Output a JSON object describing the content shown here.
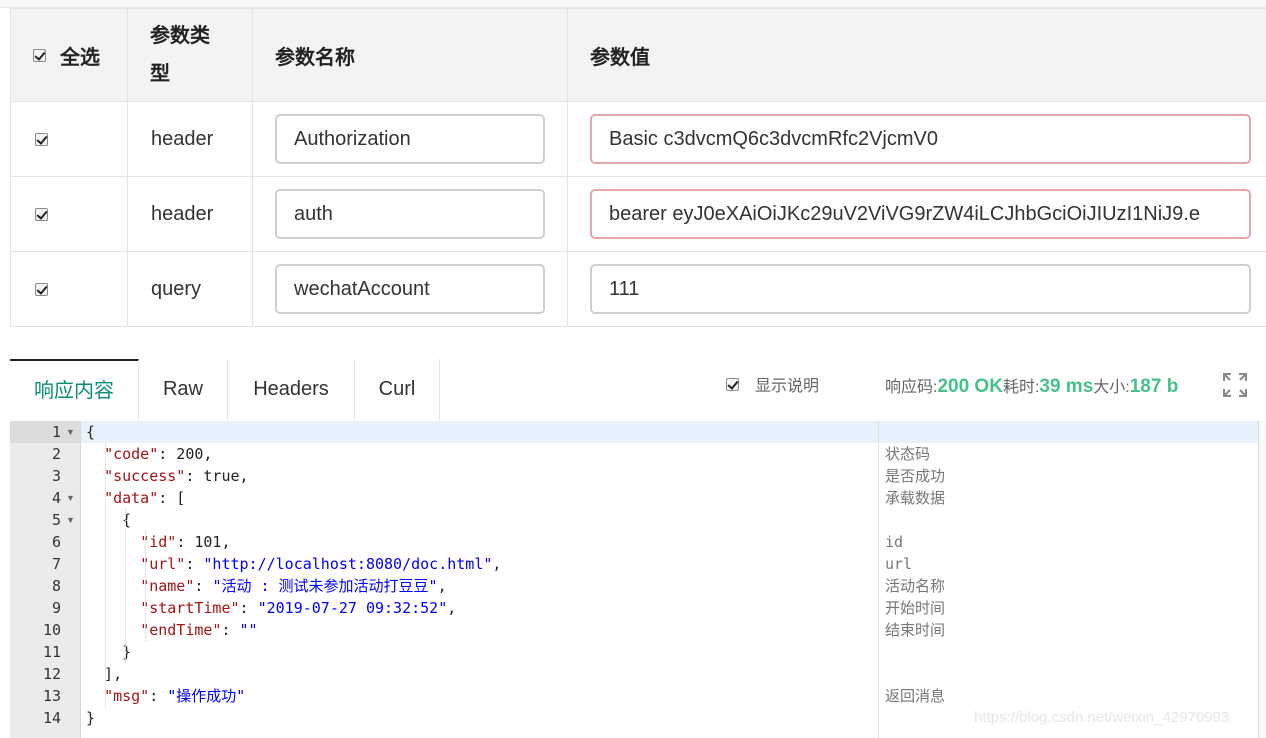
{
  "params": {
    "headers": {
      "select_all": "全选",
      "type": "参数类型",
      "name": "参数名称",
      "value": "参数值"
    },
    "rows": [
      {
        "type": "header",
        "name": "Authorization",
        "value": "Basic c3dvcmQ6c3dvcmRfc2VjcmV0",
        "checked": true,
        "invalid": true
      },
      {
        "type": "header",
        "name": "auth",
        "value": "bearer eyJ0eXAiOiJKc29uV2ViVG9rZW4iLCJhbGciOiJIUzI1NiJ9.e",
        "checked": true,
        "invalid": true
      },
      {
        "type": "query",
        "name": "wechatAccount",
        "value": "111",
        "checked": true,
        "invalid": false
      }
    ]
  },
  "response": {
    "tabs": [
      "响应内容",
      "Raw",
      "Headers",
      "Curl"
    ],
    "active_tab": "响应内容",
    "show_explain_label": "显示说明",
    "show_explain_checked": true,
    "status_code_label": "响应码:",
    "status_code": "200 OK",
    "time_label": "耗时:",
    "time_value": "39 ms",
    "size_label": "大小:",
    "size_value": "187 b",
    "fullscreen_icon": "expand-icon"
  },
  "editor": {
    "line_numbers": [
      "1",
      "2",
      "3",
      "4",
      "5",
      "6",
      "7",
      "8",
      "9",
      "10",
      "11",
      "12",
      "13",
      "14"
    ],
    "lines": [
      "{",
      "  \"code\": 200,",
      "  \"success\": true,",
      "  \"data\": [",
      "    {",
      "      \"id\": 101,",
      "      \"url\": \"http://localhost:8080/doc.html\",",
      "      \"name\": \"活动 : 测试未参加活动打豆豆\",",
      "      \"startTime\": \"2019-07-27 09:32:52\",",
      "      \"endTime\": \"\"",
      "    }",
      "  ],",
      "  \"msg\": \"操作成功\"",
      "}"
    ],
    "comments": [
      "",
      "状态码",
      "是否成功",
      "承载数据",
      "",
      "id",
      "url",
      "活动名称",
      "开始时间",
      "结束时间",
      "",
      "",
      "返回消息",
      ""
    ],
    "colors": {
      "key": "#a31515",
      "string": "#0000ff",
      "accent": "#0a8f76",
      "status": "#48c08a"
    }
  },
  "watermark": "https://blog.csdn.net/weixin_42970993"
}
